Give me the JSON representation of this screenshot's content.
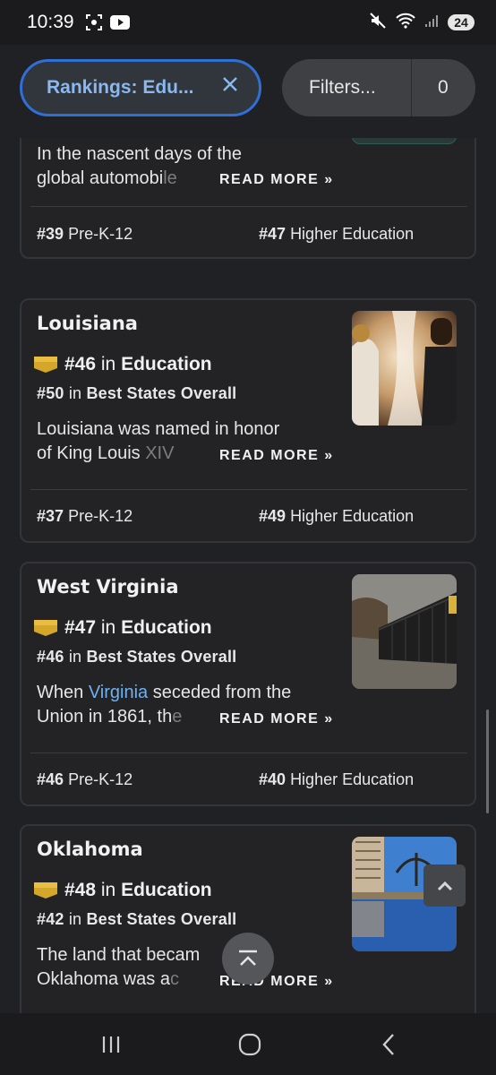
{
  "status_bar": {
    "time": "10:39",
    "battery": "24",
    "icons": [
      "screenshot-icon",
      "youtube-icon",
      "mute-icon",
      "wifi-icon",
      "signal-icon"
    ]
  },
  "filters": {
    "rankings_label": "Rankings: Edu...",
    "filters_label": "Filters...",
    "filters_count": "0",
    "accent_color": "#2f6fd6"
  },
  "cards": [
    {
      "name": "",
      "desc_visible": "In the nascent days of the global automobi",
      "desc_line1": "In the nascent days of the",
      "desc_line2_solid": "global automobi",
      "desc_line2_fade": "le",
      "read_more": "READ MORE »",
      "prek12_rank": "#39",
      "prek12_label": "Pre-K-12",
      "higher_rank": "#47",
      "higher_label": "Higher Education"
    },
    {
      "name": "Louisiana",
      "edu_rank": "#46",
      "edu_in": "in",
      "edu_label": "Education",
      "overall_rank": "#50",
      "overall_in": "in",
      "overall_label": "Best States Overall",
      "desc_line1": "Louisiana was named in honor",
      "desc_line2_solid": "of King Louis ",
      "desc_line2_fade": "XIV",
      "read_more": "READ MORE »",
      "prek12_rank": "#37",
      "prek12_label": "Pre-K-12",
      "higher_rank": "#49",
      "higher_label": "Higher Education"
    },
    {
      "name": "West Virginia",
      "edu_rank": "#47",
      "edu_in": "in",
      "edu_label": "Education",
      "overall_rank": "#46",
      "overall_in": "in",
      "overall_label": "Best States Overall",
      "desc_line1_pre": "When ",
      "desc_line1_link": "Virginia",
      "desc_line1_post": " seceded from the",
      "desc_line2_solid": "Union in 1861, th",
      "desc_line2_fade": "e",
      "read_more": "READ MORE »",
      "prek12_rank": "#46",
      "prek12_label": "Pre-K-12",
      "higher_rank": "#40",
      "higher_label": "Higher Education"
    },
    {
      "name": "Oklahoma",
      "edu_rank": "#48",
      "edu_in": "in",
      "edu_label": "Education",
      "overall_rank": "#42",
      "overall_in": "in",
      "overall_label": "Best States Overall",
      "desc_line1": "The land that becam",
      "desc_line2_solid": "Oklahoma was a",
      "desc_line2_fade": "c",
      "read_more": "READ MORE »"
    }
  ],
  "badge_color": "#d4a62a",
  "link_color": "#6fb0ef"
}
